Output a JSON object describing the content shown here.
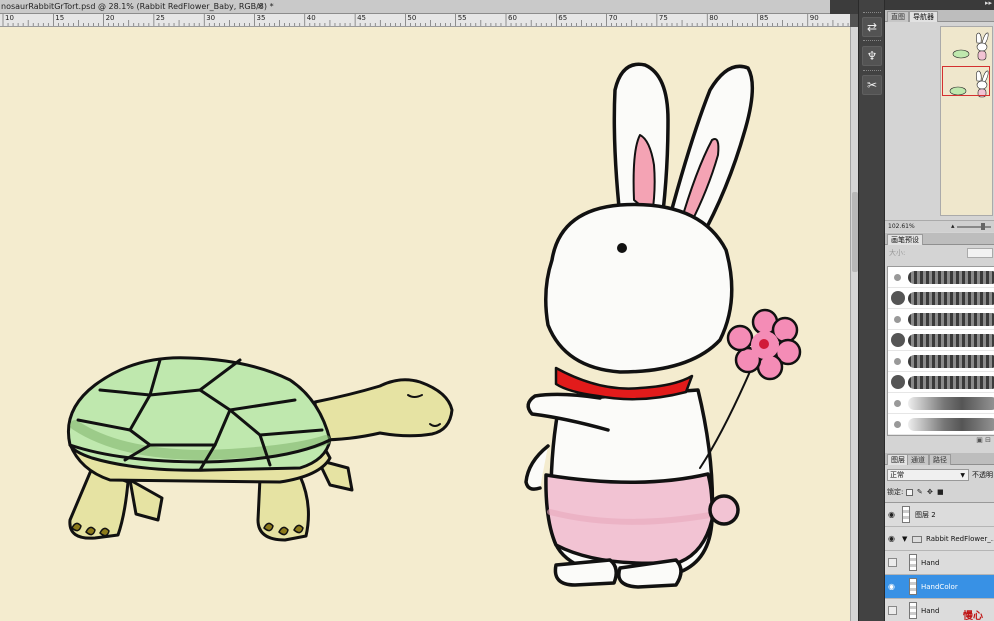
{
  "document": {
    "tab_title": "nosaurRabbitGrTort.psd @ 28.1% (Rabbit RedFlower_Baby, RGB/8) *",
    "close_glyph": "×"
  },
  "ruler": {
    "labels": [
      "10",
      "15",
      "20",
      "25",
      "30",
      "35",
      "40",
      "45",
      "50",
      "55",
      "60",
      "65",
      "70",
      "75",
      "80",
      "85",
      "90"
    ]
  },
  "tools": [
    {
      "name": "history-icon",
      "glyph": "⇄"
    },
    {
      "name": "clone-source-icon",
      "glyph": "♆"
    },
    {
      "name": "tool-presets-icon",
      "glyph": "✂"
    }
  ],
  "navigator": {
    "tabs": [
      "直图",
      "导航器"
    ],
    "zoom": "102.61%"
  },
  "brushes": {
    "tab": "画笔预设",
    "size_label": "大小:"
  },
  "layers": {
    "tabs": [
      "图层",
      "通道",
      "路径"
    ],
    "blend_mode": "正常",
    "opacity_label": "不透明",
    "lock_label": "锁定:",
    "items": [
      {
        "name": "图层 2",
        "type": "layer",
        "visible": true,
        "selected": false
      },
      {
        "name": "Rabbit RedFlower_…",
        "type": "group",
        "visible": true,
        "selected": false
      },
      {
        "name": "Hand",
        "type": "layer",
        "visible": false,
        "selected": false
      },
      {
        "name": "HandColor",
        "type": "layer",
        "visible": true,
        "selected": true
      },
      {
        "name": "Hand",
        "type": "layer",
        "visible": false,
        "selected": false
      }
    ],
    "watermark": "慢心"
  },
  "colors": {
    "canvas_bg": "#f4eccf",
    "selected_layer": "#3891e5",
    "shell_green": "#bfe8ae",
    "scarf_red": "#e21b1b",
    "pants_pink": "#f2c3d3",
    "flower_pink": "#f48cb6"
  }
}
